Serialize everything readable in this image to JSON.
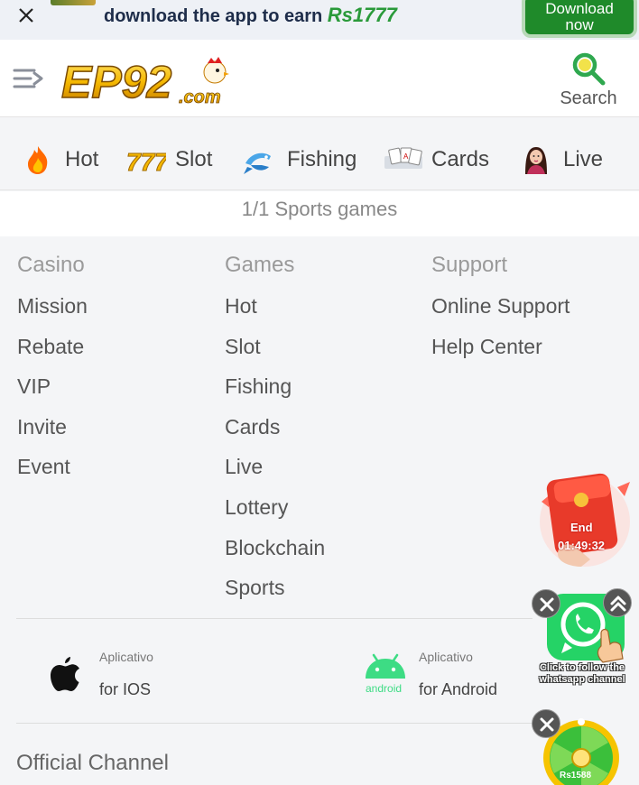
{
  "banner": {
    "message_prefix": "download the app to earn ",
    "amount": "Rs1777",
    "download_line1": "Download",
    "download_line2": "now"
  },
  "header": {
    "logo_text": "EP92",
    "logo_suffix": ".com",
    "search_label": "Search"
  },
  "categories": [
    {
      "label": "Hot",
      "icon": "fire-icon"
    },
    {
      "label": "Slot",
      "icon": "slot-777-icon"
    },
    {
      "label": "Fishing",
      "icon": "fish-icon"
    },
    {
      "label": "Cards",
      "icon": "cards-icon"
    },
    {
      "label": "Live",
      "icon": "live-dealer-icon"
    }
  ],
  "count_text": "1/1 Sports games",
  "footer": {
    "casino": {
      "heading": "Casino",
      "items": [
        "Mission",
        "Rebate",
        "VIP",
        "Invite",
        "Event"
      ]
    },
    "games": {
      "heading": "Games",
      "items": [
        "Hot",
        "Slot",
        "Fishing",
        "Cards",
        "Live",
        "Lottery",
        "Blockchain",
        "Sports"
      ]
    },
    "support": {
      "heading": "Support",
      "items": [
        "Online Support",
        "Help Center"
      ]
    }
  },
  "apps": {
    "ios": {
      "small": "Aplicativo",
      "label": "for IOS"
    },
    "android": {
      "small": "Aplicativo",
      "label": "for Android",
      "badge": "android"
    }
  },
  "official_channel": "Official Channel",
  "floats": {
    "envelope_end": "End",
    "envelope_time": "01:49:32",
    "whatsapp_text": "Click to follow the whatsapp channel",
    "wheel_amount": "Rs1588"
  },
  "colors": {
    "accent_green": "#2a9a3a",
    "download_bg": "#1f8a2a",
    "whatsapp": "#25d366"
  }
}
